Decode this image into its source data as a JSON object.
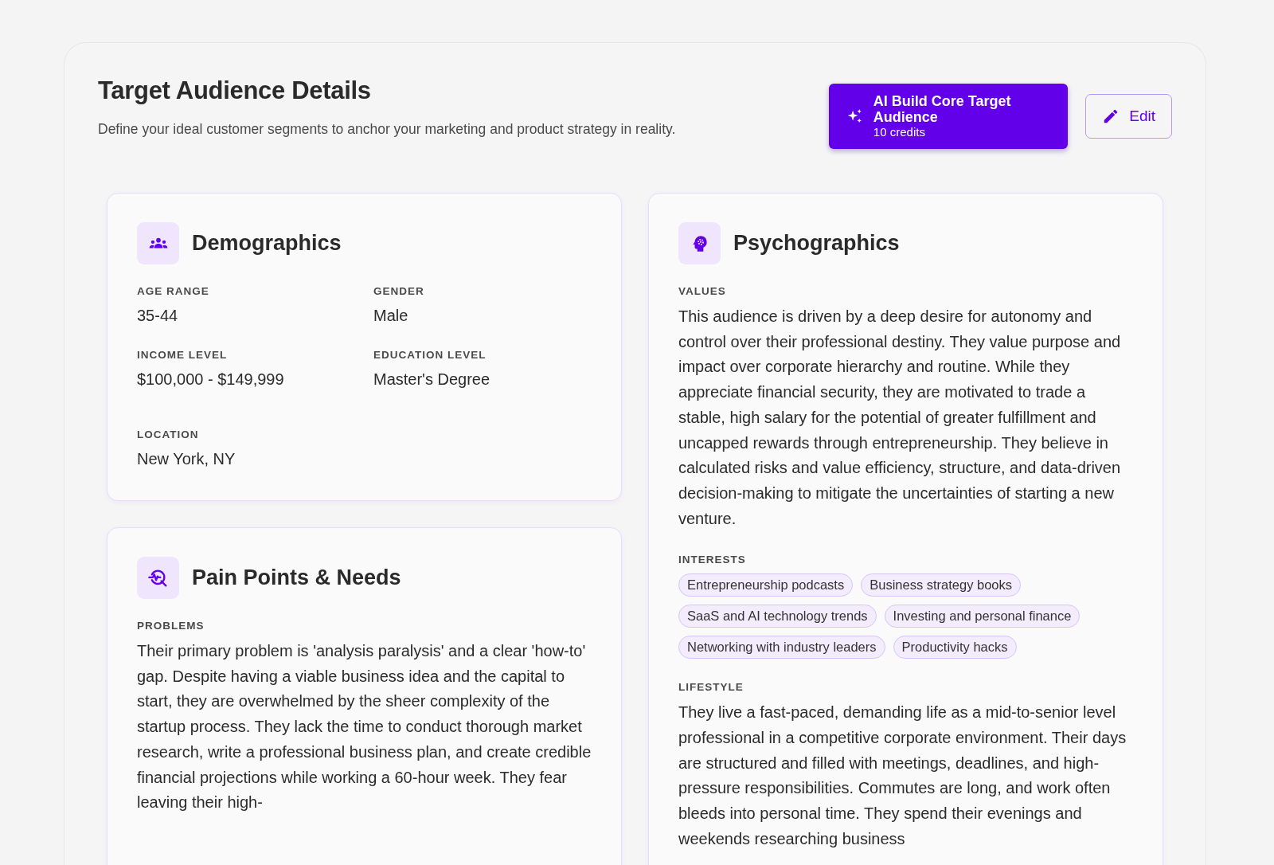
{
  "header": {
    "title": "Target Audience Details",
    "subtitle": "Define your ideal customer segments to anchor your marketing and product strategy in reality.",
    "ai_button": {
      "label": "AI Build Core Target Audience",
      "credits": "10 credits"
    },
    "edit_button": {
      "label": "Edit"
    }
  },
  "demographics": {
    "title": "Demographics",
    "fields": [
      {
        "label": "AGE RANGE",
        "value": "35-44"
      },
      {
        "label": "GENDER",
        "value": "Male"
      },
      {
        "label": "INCOME LEVEL",
        "value": "$100,000 - $149,999"
      },
      {
        "label": "EDUCATION LEVEL",
        "value": "Master's Degree"
      },
      {
        "label": "LOCATION",
        "value": "New York, NY"
      }
    ]
  },
  "pain_points": {
    "title": "Pain Points & Needs",
    "problems_label": "PROBLEMS",
    "problems": "Their primary problem is 'analysis paralysis' and a clear 'how-to' gap. Despite having a viable business idea and the capital to start, they are overwhelmed by the sheer complexity of the startup process. They lack the time to conduct thorough market research, write a professional business plan, and create credible financial projections while working a 60-hour week. They fear leaving their high-"
  },
  "psychographics": {
    "title": "Psychographics",
    "values_label": "VALUES",
    "values": "This audience is driven by a deep desire for autonomy and control over their professional destiny. They value purpose and impact over corporate hierarchy and routine. While they appreciate financial security, they are motivated to trade a stable, high salary for the potential of greater fulfillment and uncapped rewards through entrepreneurship. They believe in calculated risks and value efficiency, structure, and data-driven decision-making to mitigate the uncertainties of starting a new venture.",
    "interests_label": "INTERESTS",
    "interests": [
      "Entrepreneurship podcasts",
      "Business strategy books",
      "SaaS and AI technology trends",
      "Investing and personal finance",
      "Networking with industry leaders",
      "Productivity hacks"
    ],
    "lifestyle_label": "LIFESTYLE",
    "lifestyle": "They live a fast-paced, demanding life as a mid-to-senior level professional in a competitive corporate environment. Their days are structured and filled with meetings, deadlines, and high-pressure responsibilities. Commutes are long, and work often bleeds into personal time. They spend their evenings and weekends researching business"
  }
}
